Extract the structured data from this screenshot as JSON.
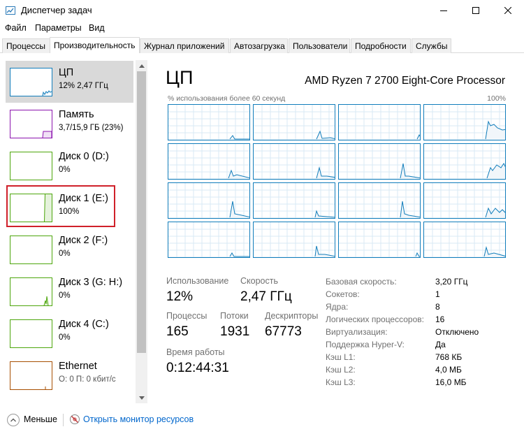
{
  "window": {
    "title": "Диспетчер задач",
    "controls": [
      "minimize-icon",
      "maximize-icon",
      "close-icon"
    ]
  },
  "menu": [
    "Файл",
    "Параметры",
    "Вид"
  ],
  "tabs": [
    {
      "label": "Процессы"
    },
    {
      "label": "Производительность",
      "active": true
    },
    {
      "label": "Журнал приложений"
    },
    {
      "label": "Автозагрузка"
    },
    {
      "label": "Пользователи"
    },
    {
      "label": "Подробности"
    },
    {
      "label": "Службы"
    }
  ],
  "sidebar": {
    "items": [
      {
        "title": "ЦП",
        "subtitle": "12% 2,47 ГГц",
        "color": "#117dbb",
        "selected": true
      },
      {
        "title": "Память",
        "subtitle": "3,7/15,9 ГБ (23%)",
        "color": "#8b12ae"
      },
      {
        "title": "Диск 0 (D:)",
        "subtitle": "0%",
        "color": "#4da60c"
      },
      {
        "title": "Диск 1 (E:)",
        "subtitle": "100%",
        "color": "#4da60c",
        "highlighted": true
      },
      {
        "title": "Диск 2 (F:)",
        "subtitle": "0%",
        "color": "#4da60c"
      },
      {
        "title": "Диск 3 (G: H:)",
        "subtitle": "0%",
        "color": "#4da60c"
      },
      {
        "title": "Диск 4 (C:)",
        "subtitle": "0%",
        "color": "#4da60c"
      },
      {
        "title": "Ethernet",
        "subtitle": "О: 0 П: 0 кбит/с",
        "color": "#a74f01"
      }
    ]
  },
  "main": {
    "title": "ЦП",
    "processor": "AMD Ryzen 7 2700 Eight-Core Processor",
    "graph_caption": "% использования более 60 секунд",
    "graph_max": "100%",
    "core_count_graphs": 16,
    "stats": {
      "usage_label": "Использование",
      "usage_value": "12%",
      "speed_label": "Скорость",
      "speed_value": "2,47 ГГц",
      "processes_label": "Процессы",
      "processes_value": "165",
      "threads_label": "Потоки",
      "threads_value": "1931",
      "handles_label": "Дескрипторы",
      "handles_value": "67773",
      "uptime_label": "Время работы",
      "uptime_value": "0:12:44:31"
    },
    "info": [
      {
        "label": "Базовая скорость:",
        "value": "3,20 ГГц"
      },
      {
        "label": "Сокетов:",
        "value": "1"
      },
      {
        "label": "Ядра:",
        "value": "8"
      },
      {
        "label": "Логических процессоров:",
        "value": "16"
      },
      {
        "label": "Виртуализация:",
        "value": "Отключено"
      },
      {
        "label": "Поддержка Hyper-V:",
        "value": "Да"
      },
      {
        "label": "Кэш L1:",
        "value": "768 КБ"
      },
      {
        "label": "Кэш L2:",
        "value": "4,0 МБ"
      },
      {
        "label": "Кэш L3:",
        "value": "16,0 МБ"
      }
    ]
  },
  "footer": {
    "less_label": "Меньше",
    "monitor_link": "Открыть монитор ресурсов"
  }
}
